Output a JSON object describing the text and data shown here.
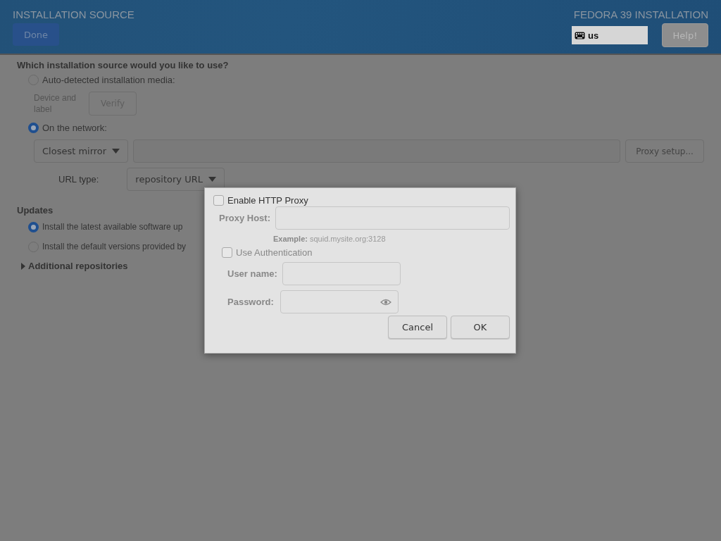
{
  "header": {
    "title": "INSTALLATION SOURCE",
    "done_button": "Done",
    "product": "FEDORA 39 INSTALLATION",
    "keyboard_layout": "us",
    "help_button": "Help!"
  },
  "source": {
    "question": "Which installation source would you like to use?",
    "options": [
      {
        "label": "Auto-detected installation media:",
        "selected": false
      },
      {
        "label": "On the network:",
        "selected": true
      }
    ],
    "device_label": "Device and label",
    "verify_button": "Verify",
    "mirror_dropdown": "Closest mirror",
    "proxy_button": "Proxy setup...",
    "url_type_label": "URL type:",
    "url_type_dropdown": "repository URL"
  },
  "updates": {
    "title": "Updates",
    "options": [
      {
        "label": "Install the latest available software up",
        "selected": true
      },
      {
        "label": "Install the default versions provided by",
        "selected": false
      }
    ]
  },
  "additional_repositories": {
    "label": "Additional repositories",
    "expanded": false
  },
  "proxy_dialog": {
    "enable_proxy": {
      "label": "Enable HTTP Proxy",
      "checked": false
    },
    "proxy_host_label": "Proxy Host:",
    "example": "**Example:** squid.mysite.org:3128",
    "use_authentication": {
      "label": "Use Authentication",
      "checked": false
    },
    "user_name_label": "User name:",
    "password_label": "Password:",
    "buttons": [
      "Cancel",
      "OK"
    ]
  }
}
